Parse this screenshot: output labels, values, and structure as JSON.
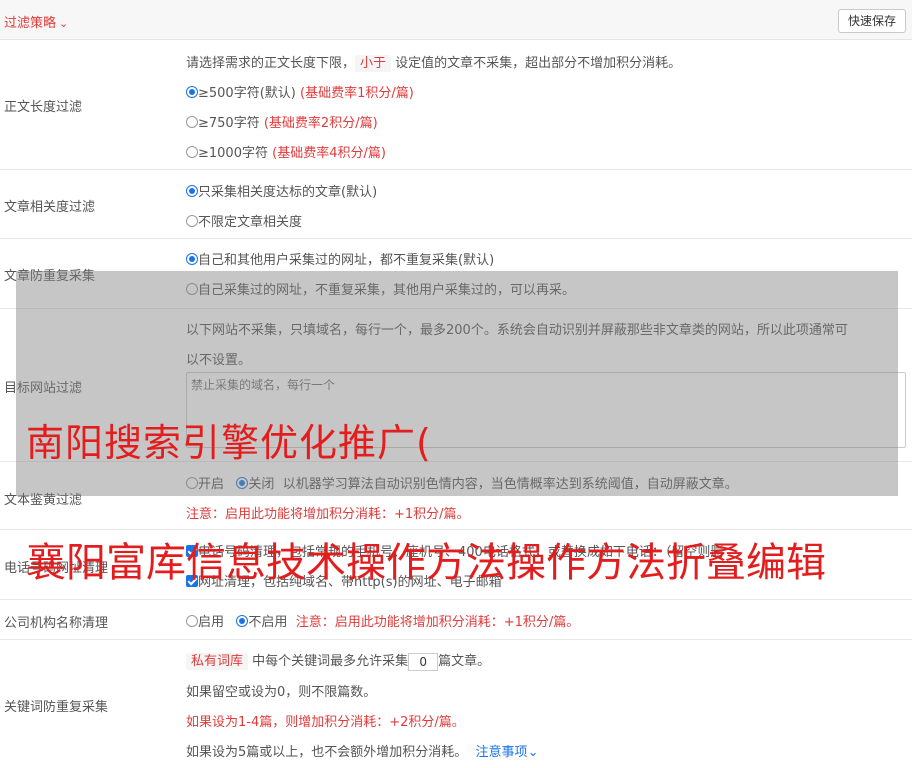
{
  "header": {
    "title": "过滤策略",
    "save_label": "快速保存"
  },
  "length_filter": {
    "label": "正文长度过滤",
    "desc_a": "请选择需求的正文长度下限，",
    "desc_tag": "小于",
    "desc_b": "设定值的文章不采集，超出部分不增加积分消耗。",
    "options": [
      {
        "text": "≥500字符(默认)",
        "note": "(基础费率1积分/篇)"
      },
      {
        "text": "≥750字符",
        "note": "(基础费率2积分/篇)"
      },
      {
        "text": "≥1000字符",
        "note": "(基础费率4积分/篇)"
      }
    ]
  },
  "relevance_filter": {
    "label": "文章相关度过滤",
    "options": [
      "只采集相关度达标的文章(默认)",
      "不限定文章相关度"
    ]
  },
  "dup_filter": {
    "label": "文章防重复采集",
    "options": [
      "自己和其他用户采集过的网址，都不重复采集(默认)",
      "自己采集过的网址，不重复采集，其他用户采集过的，可以再采。"
    ]
  },
  "site_filter": {
    "label": "目标网站过滤",
    "desc_1": "以下网站不采集，只填域名，每行一个，最多200个。系统会自动识别并屏蔽那些非文章类的网站，所以此项通常可",
    "desc_2": "以不设置。",
    "placeholder": "禁止采集的域名，每行一个"
  },
  "porn_filter": {
    "label": "文本鉴黄过滤",
    "on": "开启",
    "off": "关闭",
    "desc": "以机器学习算法自动识别色情内容，当色情概率达到系统阈值，自动屏蔽文章。",
    "note": "注意：启用此功能将增加积分消耗：+1积分/篇。"
  },
  "phone_filter": {
    "label": "电话号码网址清理",
    "line1": "电话号码清理，包括常规的手机号、座机号、400电话格式，或替换成如下电话：（留空则删",
    "line2": "网址清理，包括纯域名、带http(s)的网址、电子邮箱"
  },
  "company_filter": {
    "label": "公司机构名称清理",
    "on": "启用",
    "off": "不启用",
    "note": "注意：启用此功能将增加积分消耗：+1积分/篇。"
  },
  "keyword_filter": {
    "label": "关键词防重复采集",
    "tag": "私有词库",
    "text_a": "中每个关键词最多允许采集",
    "value": "0",
    "text_b": "篇文章。",
    "line2": "如果留空或设为0，则不限篇数。",
    "line3": "如果设为1-4篇，则增加积分消耗：+2积分/篇。",
    "line4": "如果设为5篇或以上，也不会额外增加积分消耗。",
    "link": "注意事项"
  },
  "watermark": {
    "line1": "南阳搜索引擎优化推广(",
    "line2": "襄阳富库信息技术操作方法操作方法折叠编辑"
  }
}
